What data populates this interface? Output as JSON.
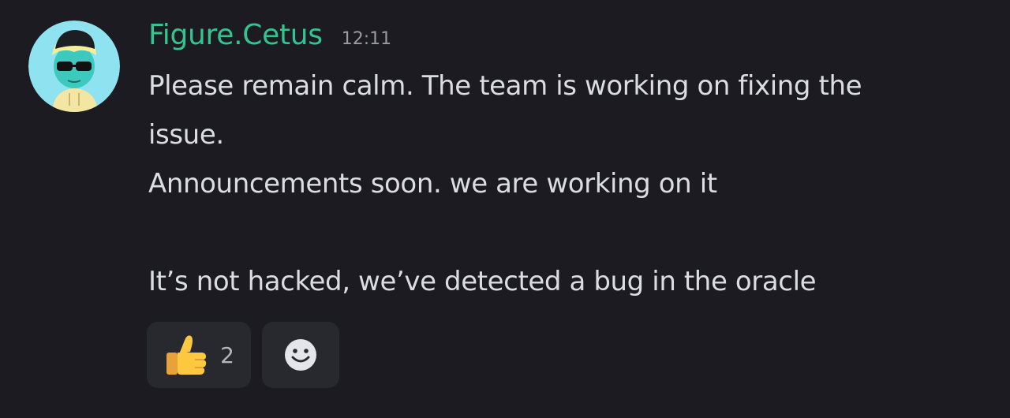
{
  "message": {
    "author": "Figure.Cetus",
    "timestamp": "12:11",
    "lines": [
      "Please remain calm. The team is working on fixing the",
      "issue.",
      "Announcements soon. we are working on it",
      "",
      "It’s not hacked, we’ve detected a bug in the oracle"
    ]
  },
  "reactions": [
    {
      "icon": "thumbs-up-icon",
      "count": "2"
    }
  ],
  "add_reaction_icon": "smiley-add-reaction-icon",
  "colors": {
    "background": "#1b1b21",
    "username": "#34c48f",
    "text": "#dcdde2",
    "timestamp": "#9a9ba2",
    "reaction_bg": "#28282f"
  }
}
